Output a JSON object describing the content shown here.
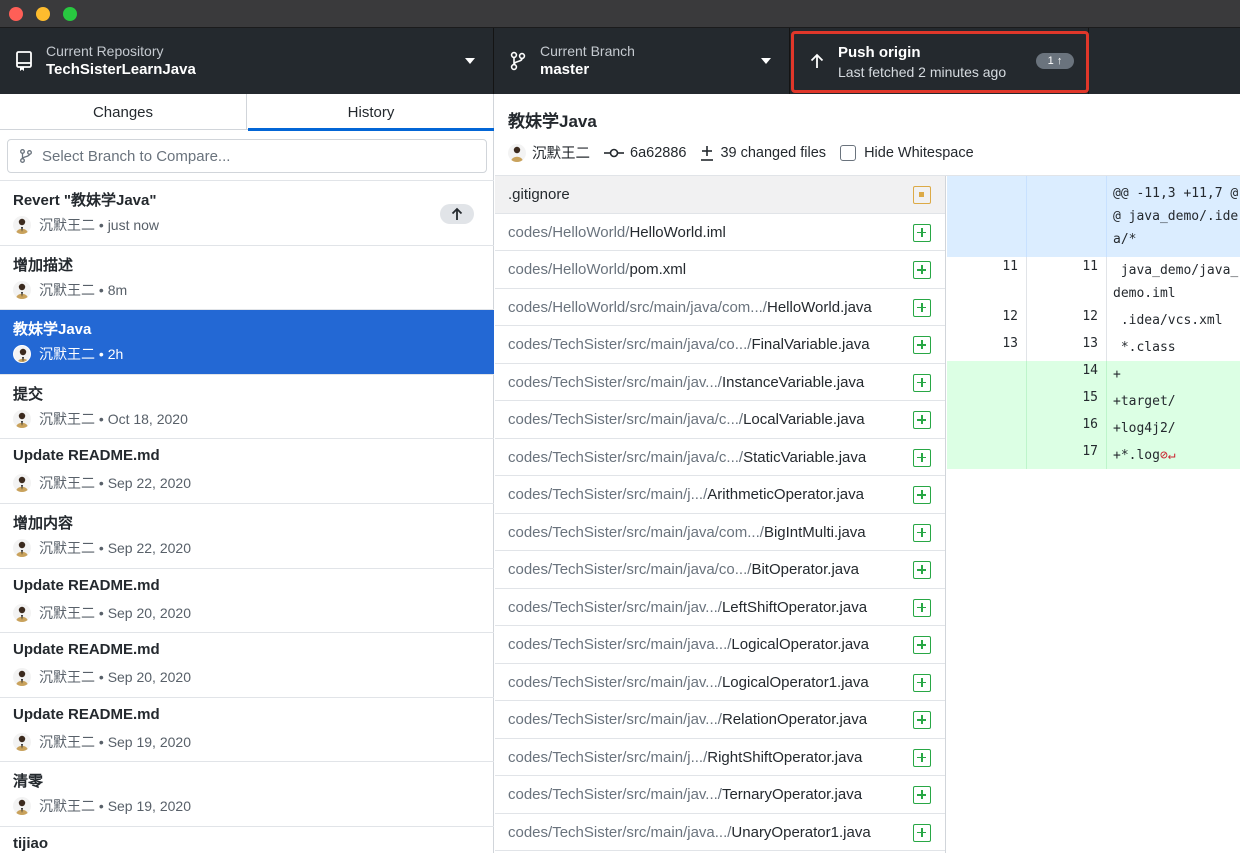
{
  "toolbar": {
    "repo_label": "Current Repository",
    "repo_name": "TechSisterLearnJava",
    "branch_label": "Current Branch",
    "branch_name": "master",
    "push_title": "Push origin",
    "push_subtitle": "Last fetched 2 minutes ago",
    "push_badge": "1 ↑"
  },
  "tabs": {
    "changes": "Changes",
    "history": "History"
  },
  "compare": {
    "placeholder": "Select Branch to Compare..."
  },
  "commits": [
    {
      "title": "Revert \"教妹学Java\"",
      "author": "沉默王二",
      "time": "just now",
      "unpushed": true
    },
    {
      "title": "增加描述",
      "author": "沉默王二",
      "time": "8m"
    },
    {
      "title": "教妹学Java",
      "author": "沉默王二",
      "time": "2h",
      "selected": true
    },
    {
      "title": "提交",
      "author": "沉默王二",
      "time": "Oct 18, 2020"
    },
    {
      "title": "Update README.md",
      "author": "沉默王二",
      "time": "Sep 22, 2020"
    },
    {
      "title": "增加内容",
      "author": "沉默王二",
      "time": "Sep 22, 2020"
    },
    {
      "title": "Update README.md",
      "author": "沉默王二",
      "time": "Sep 20, 2020"
    },
    {
      "title": "Update README.md",
      "author": "沉默王二",
      "time": "Sep 20, 2020"
    },
    {
      "title": "Update README.md",
      "author": "沉默王二",
      "time": "Sep 19, 2020"
    },
    {
      "title": "清零",
      "author": "沉默王二",
      "time": "Sep 19, 2020"
    },
    {
      "title": "tijiao",
      "author": "",
      "time": ""
    }
  ],
  "selected_commit": {
    "summary": "教妹学Java",
    "author": "沉默王二",
    "sha": "6a62886",
    "changed_files": "39 changed files",
    "hide_whitespace": "Hide Whitespace"
  },
  "files": [
    {
      "path": "",
      "name": ".gitignore",
      "status": "modified",
      "selected": true
    },
    {
      "path": "codes/HelloWorld/",
      "name": "HelloWorld.iml",
      "status": "added"
    },
    {
      "path": "codes/HelloWorld/",
      "name": "pom.xml",
      "status": "added"
    },
    {
      "path": "codes/HelloWorld/src/main/java/com.../",
      "name": "HelloWorld.java",
      "status": "added"
    },
    {
      "path": "codes/TechSister/src/main/java/co.../",
      "name": "FinalVariable.java",
      "status": "added"
    },
    {
      "path": "codes/TechSister/src/main/jav.../",
      "name": "InstanceVariable.java",
      "status": "added"
    },
    {
      "path": "codes/TechSister/src/main/java/c.../",
      "name": "LocalVariable.java",
      "status": "added"
    },
    {
      "path": "codes/TechSister/src/main/java/c.../",
      "name": "StaticVariable.java",
      "status": "added"
    },
    {
      "path": "codes/TechSister/src/main/j.../",
      "name": "ArithmeticOperator.java",
      "status": "added"
    },
    {
      "path": "codes/TechSister/src/main/java/com.../",
      "name": "BigIntMulti.java",
      "status": "added"
    },
    {
      "path": "codes/TechSister/src/main/java/co.../",
      "name": "BitOperator.java",
      "status": "added"
    },
    {
      "path": "codes/TechSister/src/main/jav.../",
      "name": "LeftShiftOperator.java",
      "status": "added"
    },
    {
      "path": "codes/TechSister/src/main/java.../",
      "name": "LogicalOperator.java",
      "status": "added"
    },
    {
      "path": "codes/TechSister/src/main/jav.../",
      "name": "LogicalOperator1.java",
      "status": "added"
    },
    {
      "path": "codes/TechSister/src/main/jav.../",
      "name": "RelationOperator.java",
      "status": "added"
    },
    {
      "path": "codes/TechSister/src/main/j.../",
      "name": "RightShiftOperator.java",
      "status": "added"
    },
    {
      "path": "codes/TechSister/src/main/jav.../",
      "name": "TernaryOperator.java",
      "status": "added"
    },
    {
      "path": "codes/TechSister/src/main/java.../",
      "name": "UnaryOperator1.java",
      "status": "added"
    }
  ],
  "diff": [
    {
      "type": "hunk",
      "old": "",
      "new": "",
      "code": "@@ -11,3 +11,7 @@ java_demo/.idea/*"
    },
    {
      "type": "context",
      "old": "11",
      "new": "11",
      "code": " java_demo/java_demo.iml"
    },
    {
      "type": "context",
      "old": "12",
      "new": "12",
      "code": " .idea/vcs.xml"
    },
    {
      "type": "context",
      "old": "13",
      "new": "13",
      "code": " *.class"
    },
    {
      "type": "add",
      "old": "",
      "new": "14",
      "code": "+"
    },
    {
      "type": "add",
      "old": "",
      "new": "15",
      "code": "+target/"
    },
    {
      "type": "add",
      "old": "",
      "new": "16",
      "code": "+log4j2/"
    },
    {
      "type": "add",
      "old": "",
      "new": "17",
      "code": "+*.log",
      "no_eol": "⊘↵"
    }
  ]
}
